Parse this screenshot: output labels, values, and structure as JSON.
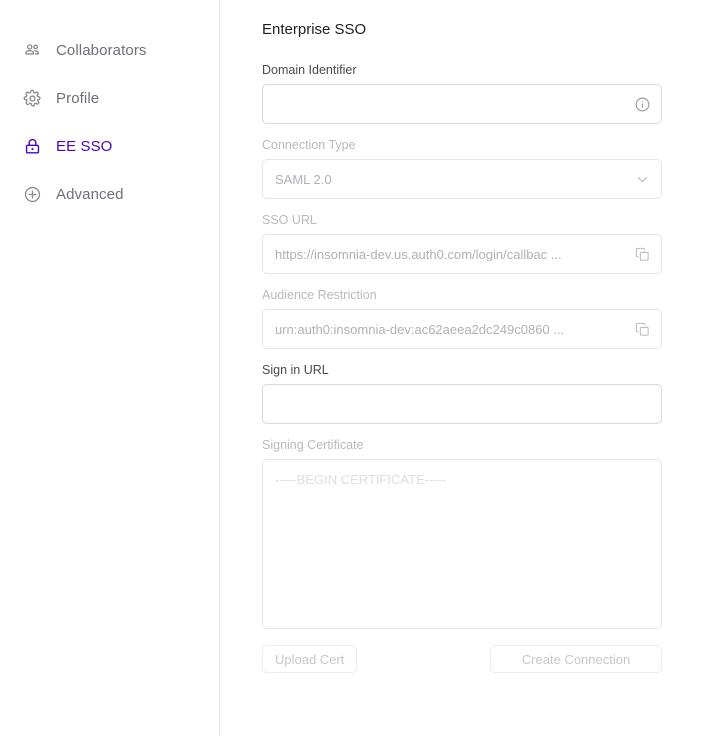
{
  "sidebar": {
    "items": [
      {
        "label": "Collaborators",
        "icon": "users-icon",
        "active": false
      },
      {
        "label": "Profile",
        "icon": "gear-icon",
        "active": false
      },
      {
        "label": "EE SSO",
        "icon": "lock-icon",
        "active": true
      },
      {
        "label": "Advanced",
        "icon": "plus-circle-icon",
        "active": false
      }
    ]
  },
  "main": {
    "title": "Enterprise SSO",
    "fields": {
      "domain_identifier": {
        "label": "Domain Identifier",
        "value": "",
        "placeholder": "",
        "affix_icon": "info-icon",
        "disabled": false
      },
      "connection_type": {
        "label": "Connection Type",
        "value": "SAML 2.0",
        "affix_icon": "chevron-down-icon",
        "disabled": true
      },
      "sso_url": {
        "label": "SSO URL",
        "value": "https://insomnia-dev.us.auth0.com/login/callbac ...",
        "affix_icon": "copy-icon",
        "disabled": true
      },
      "audience_restriction": {
        "label": "Audience Restriction",
        "value": "urn:auth0:insomnia-dev:ac62aeea2dc249c0860 ...",
        "affix_icon": "copy-icon",
        "disabled": true
      },
      "sign_in_url": {
        "label": "Sign in URL",
        "value": "",
        "placeholder": "",
        "disabled": false
      },
      "signing_certificate": {
        "label": "Signing Certificate",
        "value": "",
        "placeholder": "-----BEGIN CERTIFICATE-----",
        "disabled": true
      }
    },
    "buttons": {
      "upload_cert": "Upload Cert",
      "create_connection": "Create Connection"
    }
  },
  "colors": {
    "accent": "#4b02c4",
    "label": "#4a4a52",
    "label_disabled": "#b9b9c0",
    "border": "#d8d8dd",
    "border_disabled": "#e6e6ea",
    "placeholder": "#dedee3"
  }
}
